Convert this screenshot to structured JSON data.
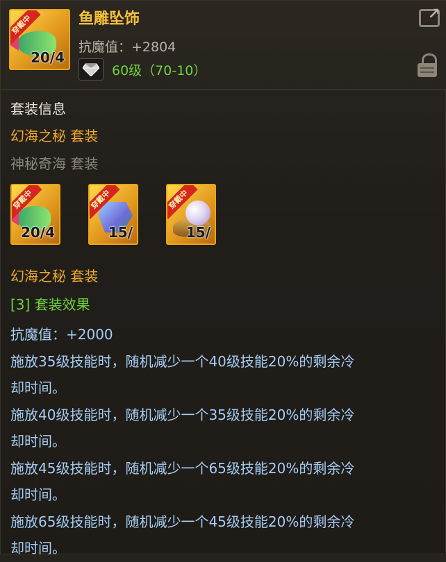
{
  "item": {
    "name": "鱼雕坠饰",
    "stat": "抗魔值：+2804",
    "level_text": "60级（70-10）",
    "icon_level": "20/4",
    "wearing_tag": "穿戴中",
    "icon": "gem-icon"
  },
  "set_info": {
    "title": "套装信息",
    "set_active_name": "幻海之秘  套装",
    "set_inactive_name": "神秘奇海  套装",
    "pieces": [
      {
        "level": "20/4",
        "wearing": "穿戴中",
        "icon": "fish-pendant-icon"
      },
      {
        "level": "15/",
        "wearing": "穿戴中",
        "icon": "crystal-icon"
      },
      {
        "level": "15/",
        "wearing": "穿戴中",
        "icon": "pearl-shell-icon"
      }
    ],
    "set_name_repeat": "幻海之秘  套装",
    "effect_title": "[3] 套装效果",
    "effect_lines": [
      "抗魔值：+2000",
      "施放35级技能时，随机减少一个40级技能20%的剩余冷",
      "却时间。",
      "施放40级技能时，随机减少一个35级技能20%的剩余冷",
      "却时间。",
      "施放45级技能时，随机减少一个65级技能20%的剩余冷",
      "却时间。",
      "施放65级技能时，随机减少一个45级技能20%的剩余冷",
      "却时间。"
    ]
  },
  "colors": {
    "gold": "#f3c03b",
    "green": "#6fd33a",
    "blue_text": "#a5cdf3",
    "gray": "#8a857c"
  }
}
